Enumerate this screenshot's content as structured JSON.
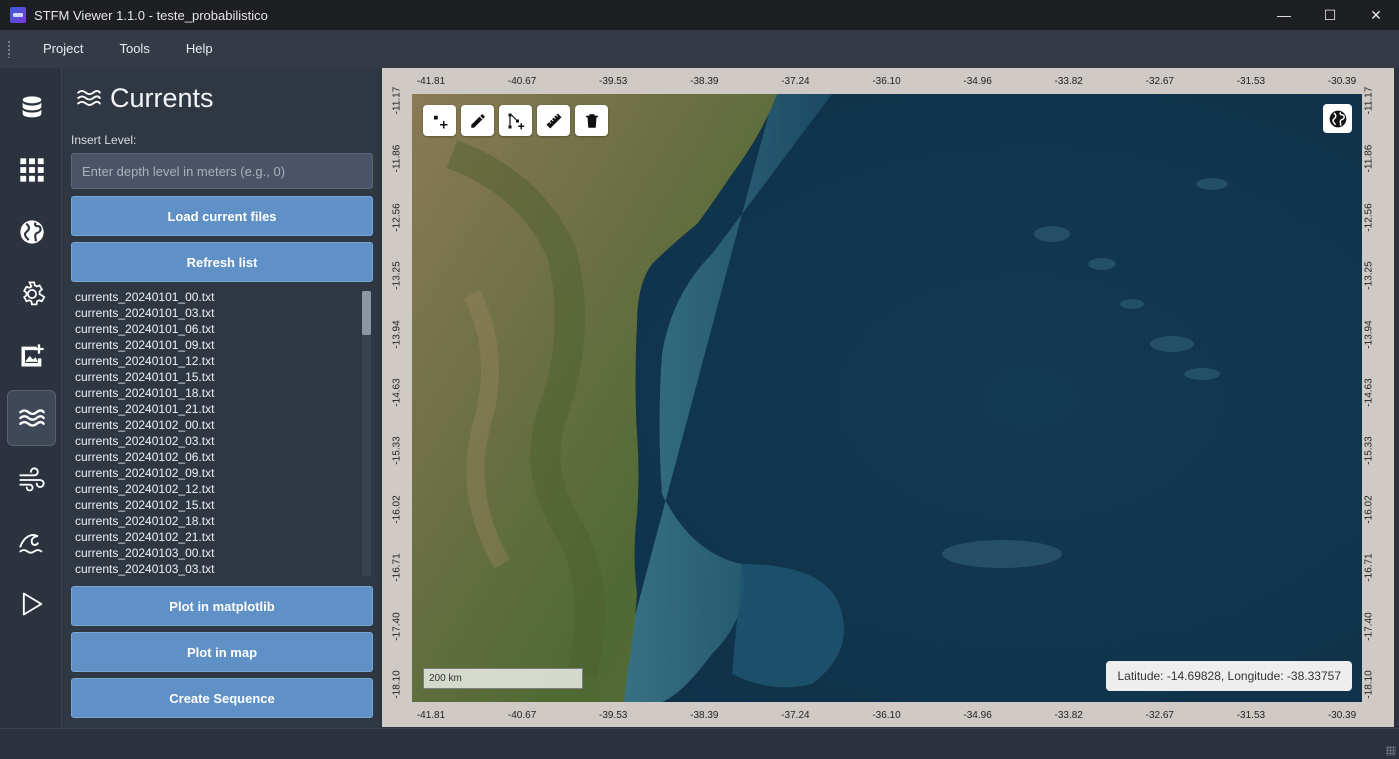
{
  "window": {
    "title": "STFM Viewer 1.1.0 - teste_probabilistico",
    "controls": {
      "minimize": "—",
      "maximize": "☐",
      "close": "✕"
    }
  },
  "menu": {
    "items": [
      "Project",
      "Tools",
      "Help"
    ]
  },
  "rail": {
    "items": [
      {
        "icon": "database-icon"
      },
      {
        "icon": "grid-icon"
      },
      {
        "icon": "globe-icon"
      },
      {
        "icon": "gear-icon"
      },
      {
        "icon": "add-image-icon"
      },
      {
        "icon": "waves-icon",
        "active": true
      },
      {
        "icon": "wind-icon"
      },
      {
        "icon": "ocean-wave-icon"
      },
      {
        "icon": "play-icon"
      }
    ]
  },
  "panel": {
    "title": "Currents",
    "insert_label": "Insert Level:",
    "depth_placeholder": "Enter depth level in meters (e.g., 0)",
    "load_button": "Load current files",
    "refresh_button": "Refresh list",
    "files": [
      "currents_20240101_00.txt",
      "currents_20240101_03.txt",
      "currents_20240101_06.txt",
      "currents_20240101_09.txt",
      "currents_20240101_12.txt",
      "currents_20240101_15.txt",
      "currents_20240101_18.txt",
      "currents_20240101_21.txt",
      "currents_20240102_00.txt",
      "currents_20240102_03.txt",
      "currents_20240102_06.txt",
      "currents_20240102_09.txt",
      "currents_20240102_12.txt",
      "currents_20240102_15.txt",
      "currents_20240102_18.txt",
      "currents_20240102_21.txt",
      "currents_20240103_00.txt",
      "currents_20240103_03.txt"
    ],
    "plot_matplotlib_button": "Plot in matplotlib",
    "plot_map_button": "Plot in map",
    "create_sequence_button": "Create Sequence"
  },
  "map": {
    "lon_ticks": [
      "-41.81",
      "-40.67",
      "-39.53",
      "-38.39",
      "-37.24",
      "-36.10",
      "-34.96",
      "-33.82",
      "-32.67",
      "-31.53",
      "-30.39"
    ],
    "lat_ticks": [
      "-11.17",
      "-11.86",
      "-12.56",
      "-13.25",
      "-13.94",
      "-14.63",
      "-15.33",
      "-16.02",
      "-16.71",
      "-17.40",
      "-18.10"
    ],
    "tools": [
      "add-point-icon",
      "pencil-icon",
      "polyline-icon",
      "ruler-icon",
      "trash-icon"
    ],
    "scale_label": "200 km",
    "coordinate_readout": "Latitude: -14.69828, Longitude: -38.33757",
    "colors": {
      "ocean": "#18435a",
      "land": "#5f6e3a"
    }
  }
}
